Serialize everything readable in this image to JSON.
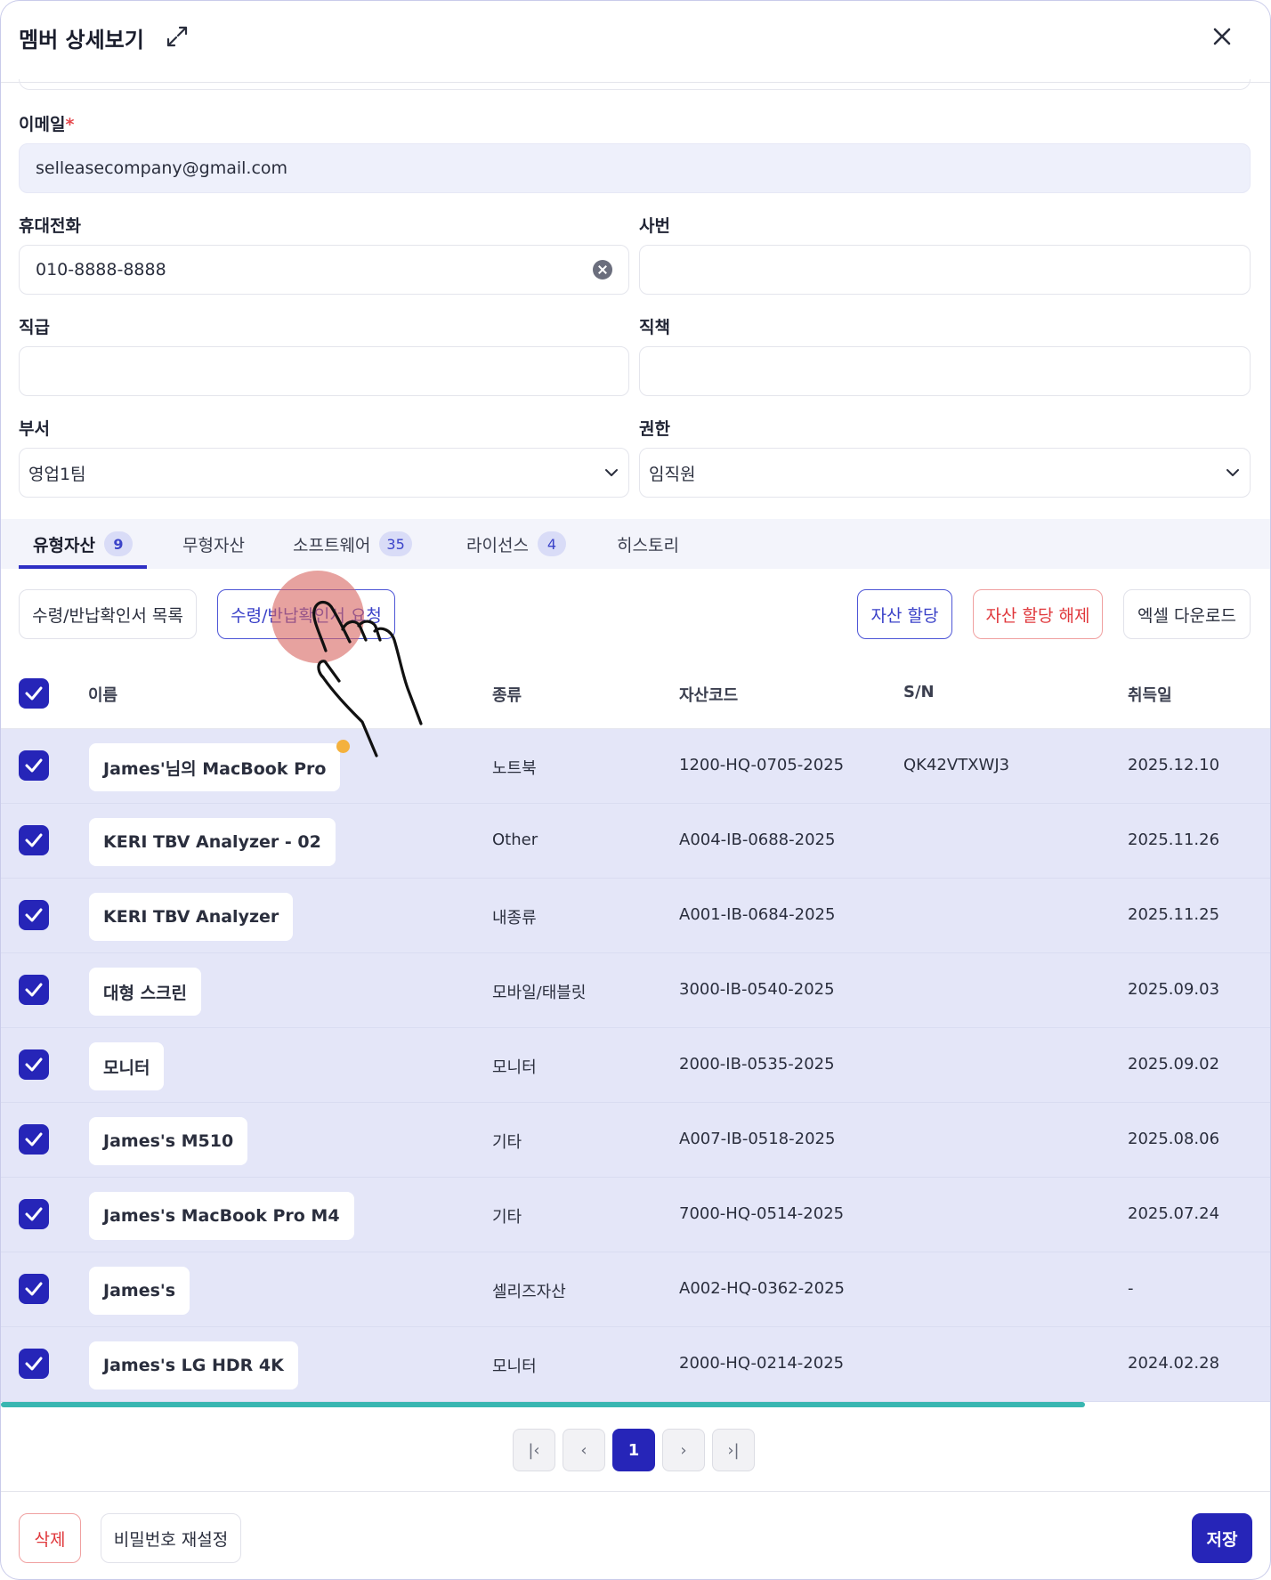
{
  "modal": {
    "title": "멤버 상세보기"
  },
  "form": {
    "email": {
      "label": "이메일",
      "required_mark": "*",
      "value": "selleasecompany@gmail.com"
    },
    "phone": {
      "label": "휴대전화",
      "value": "010-8888-8888"
    },
    "employee_no": {
      "label": "사번",
      "value": ""
    },
    "grade": {
      "label": "직급",
      "value": ""
    },
    "position": {
      "label": "직책",
      "value": ""
    },
    "department": {
      "label": "부서",
      "value": "영업1팀"
    },
    "role": {
      "label": "권한",
      "value": "임직원"
    }
  },
  "tabs": [
    {
      "label": "유형자산",
      "badge": "9",
      "active": true
    },
    {
      "label": "무형자산",
      "badge": "",
      "active": false
    },
    {
      "label": "소프트웨어",
      "badge": "35",
      "active": false
    },
    {
      "label": "라이선스",
      "badge": "4",
      "active": false
    },
    {
      "label": "히스토리",
      "badge": "",
      "active": false
    }
  ],
  "actions": {
    "receipt_list": "수령/반납확인서 목록",
    "receipt_request": "수령/반납확인서 요청",
    "assign": "자산 할당",
    "unassign": "자산 할당 해제",
    "excel": "엑셀 다운로드"
  },
  "table": {
    "columns": {
      "name": "이름",
      "type": "종류",
      "code": "자산코드",
      "sn": "S/N",
      "acquired": "취득일"
    },
    "rows": [
      {
        "name": "James'님의 MacBook Pro",
        "type": "노트북",
        "code": "1200-HQ-0705-2025",
        "sn": "QK42VTXWJ3",
        "acquired": "2025.12.10",
        "checked": true,
        "dot": true
      },
      {
        "name": "KERI TBV Analyzer - 02",
        "type": "Other",
        "code": "A004-IB-0688-2025",
        "sn": "",
        "acquired": "2025.11.26",
        "checked": true,
        "dot": false
      },
      {
        "name": "KERI TBV Analyzer",
        "type": "내종류",
        "code": "A001-IB-0684-2025",
        "sn": "",
        "acquired": "2025.11.25",
        "checked": true,
        "dot": false
      },
      {
        "name": "대형 스크린",
        "type": "모바일/태블릿",
        "code": "3000-IB-0540-2025",
        "sn": "",
        "acquired": "2025.09.03",
        "checked": true,
        "dot": false
      },
      {
        "name": "모니터",
        "type": "모니터",
        "code": "2000-IB-0535-2025",
        "sn": "",
        "acquired": "2025.09.02",
        "checked": true,
        "dot": false
      },
      {
        "name": "James's M510",
        "type": "기타",
        "code": "A007-IB-0518-2025",
        "sn": "",
        "acquired": "2025.08.06",
        "checked": true,
        "dot": false
      },
      {
        "name": "James's MacBook Pro M4",
        "type": "기타",
        "code": "7000-HQ-0514-2025",
        "sn": "",
        "acquired": "2025.07.24",
        "checked": true,
        "dot": false
      },
      {
        "name": "James's",
        "type": "셀리즈자산",
        "code": "A002-HQ-0362-2025",
        "sn": "",
        "acquired": "-",
        "checked": true,
        "dot": false
      },
      {
        "name": "James's LG HDR 4K",
        "type": "모니터",
        "code": "2000-HQ-0214-2025",
        "sn": "",
        "acquired": "2024.02.28",
        "checked": true,
        "dot": false
      }
    ]
  },
  "pagination": {
    "current": "1",
    "first": "|‹",
    "prev": "‹",
    "next": "›",
    "last": "›|"
  },
  "footer": {
    "delete": "삭제",
    "reset_password": "비밀번호 재설정",
    "save": "저장"
  },
  "colors": {
    "primary": "#2625b8",
    "row_selected": "#e4e6f8",
    "danger": "#e0383c",
    "scroll": "#38b6b1",
    "dot": "#f4b13d"
  }
}
